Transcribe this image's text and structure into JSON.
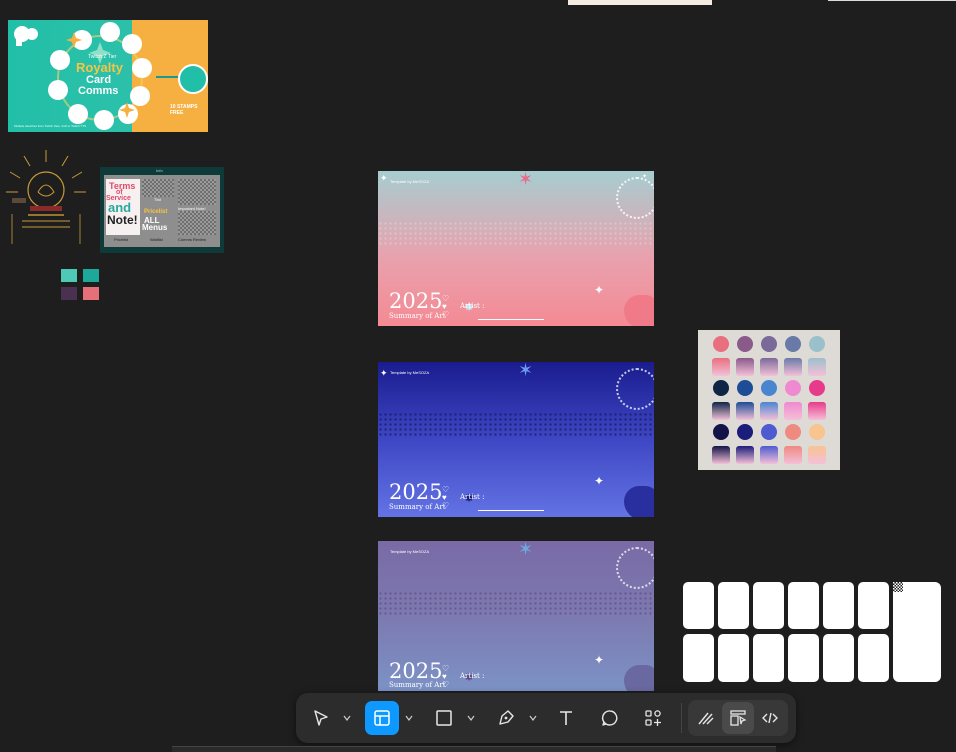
{
  "royalty_card": {
    "sub": "Twitch Z Tier",
    "title_1": "Royalty",
    "title_2": "Card",
    "title_3": "Comms",
    "stamp_note_1": "10 STAMPS",
    "stamp_note_2": "FREE",
    "footer": "Multiple sketches from Twitch Zeto, Kofi or Twitch TTS"
  },
  "tos_card": {
    "header": "Info",
    "tos_1": "Terms",
    "tos_2": "of",
    "tos_3": "Service",
    "and": "and",
    "note": "Note!",
    "tbd": "Tbd",
    "important": "Important Note!",
    "pricelist": "Pricelist",
    "all": "ALL",
    "menus": "Menus",
    "labels": [
      "Pricelist",
      "Waitlist",
      "Comms Review"
    ]
  },
  "swatches": [
    "#4ec9b6",
    "#1ea89a",
    "#4a3150",
    "#e5707a"
  ],
  "summary_frames": [
    {
      "top_note": "Template by MeSOZA",
      "year": "2025",
      "subtitle": "Summary of Art",
      "artist": "Artist :"
    },
    {
      "top_note": "Template by MeSOZA",
      "year": "2025",
      "subtitle": "Summary of Art",
      "artist": "Artist :"
    },
    {
      "top_note": "Template by MeSOZA",
      "year": "2025",
      "subtitle": "Summary of Art",
      "artist": "Artist :"
    }
  ],
  "palette": [
    [
      "#e8707e",
      "#8a5a8a",
      "#7a6a9a",
      "#6a7aa8",
      "#9ac0cc"
    ],
    [
      "#0e2545",
      "#1c4d96",
      "#4a86d0",
      "#f08ad0",
      "#e83a8a"
    ],
    [
      "#121348",
      "#1a1d7a",
      "#4e5ad0",
      "#ee8a80",
      "#f8c490"
    ]
  ],
  "toolbar": {
    "tools": [
      "move",
      "frame",
      "shape",
      "pen",
      "text",
      "comment",
      "actions"
    ],
    "dev": [
      "draw",
      "design",
      "dev-mode"
    ]
  }
}
